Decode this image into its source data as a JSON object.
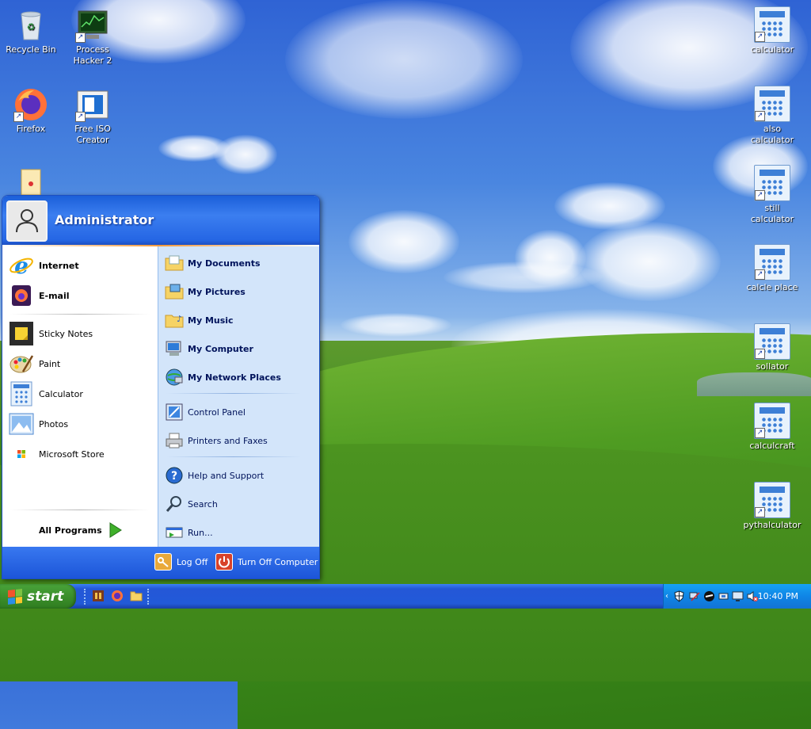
{
  "desktop": {
    "left_icons": [
      {
        "label": "Recycle Bin",
        "icon": "recycle-bin-icon"
      },
      {
        "label": "Process Hacker 2",
        "icon": "process-hacker-icon"
      },
      {
        "label": "Firefox",
        "icon": "firefox-icon"
      },
      {
        "label": "Free ISO Creator",
        "icon": "iso-creator-icon"
      }
    ],
    "right_icons": [
      {
        "label": "calculator",
        "icon": "calculator-icon"
      },
      {
        "label": "also calculator",
        "icon": "calculator-icon"
      },
      {
        "label": "still calculator",
        "icon": "calculator-icon"
      },
      {
        "label": "calcle place",
        "icon": "calculator-icon"
      },
      {
        "label": "sollator",
        "icon": "calculator-icon"
      },
      {
        "label": "calculcraft",
        "icon": "calculator-icon"
      },
      {
        "label": "pythalculator",
        "icon": "calculator-icon"
      }
    ]
  },
  "start_menu": {
    "username": "Administrator",
    "pinned": [
      {
        "label": "Internet",
        "icon": "internet-explorer-icon"
      },
      {
        "label": "E-mail",
        "icon": "email-icon"
      }
    ],
    "recent": [
      {
        "label": "Sticky Notes",
        "icon": "sticky-notes-icon"
      },
      {
        "label": "Paint",
        "icon": "paint-icon"
      },
      {
        "label": "Calculator",
        "icon": "calculator-icon"
      },
      {
        "label": "Photos",
        "icon": "photos-icon"
      },
      {
        "label": "Microsoft Store",
        "icon": "microsoft-store-icon"
      }
    ],
    "all_programs": "All Programs",
    "places": [
      {
        "label": "My Documents",
        "icon": "folder-documents-icon"
      },
      {
        "label": "My Pictures",
        "icon": "folder-pictures-icon"
      },
      {
        "label": "My Music",
        "icon": "folder-music-icon"
      },
      {
        "label": "My Computer",
        "icon": "my-computer-icon"
      },
      {
        "label": "My Network Places",
        "icon": "network-places-icon"
      }
    ],
    "system": [
      {
        "label": "Control Panel",
        "icon": "control-panel-icon"
      },
      {
        "label": "Printers and Faxes",
        "icon": "printer-icon"
      }
    ],
    "help": [
      {
        "label": "Help and Support",
        "icon": "help-icon"
      },
      {
        "label": "Search",
        "icon": "search-icon"
      },
      {
        "label": "Run...",
        "icon": "run-icon"
      }
    ],
    "log_off": "Log Off",
    "turn_off": "Turn Off Computer"
  },
  "taskbar": {
    "start_label": "start",
    "quick_launch": [
      "app-icon",
      "firefox-icon",
      "folder-icon"
    ],
    "clock": "10:40 PM"
  },
  "colors": {
    "taskbar_blue": "#245edb",
    "start_green": "#3c8f2b",
    "tray_blue": "#0f85e6",
    "menu_right_panel": "#d3e5fa"
  }
}
